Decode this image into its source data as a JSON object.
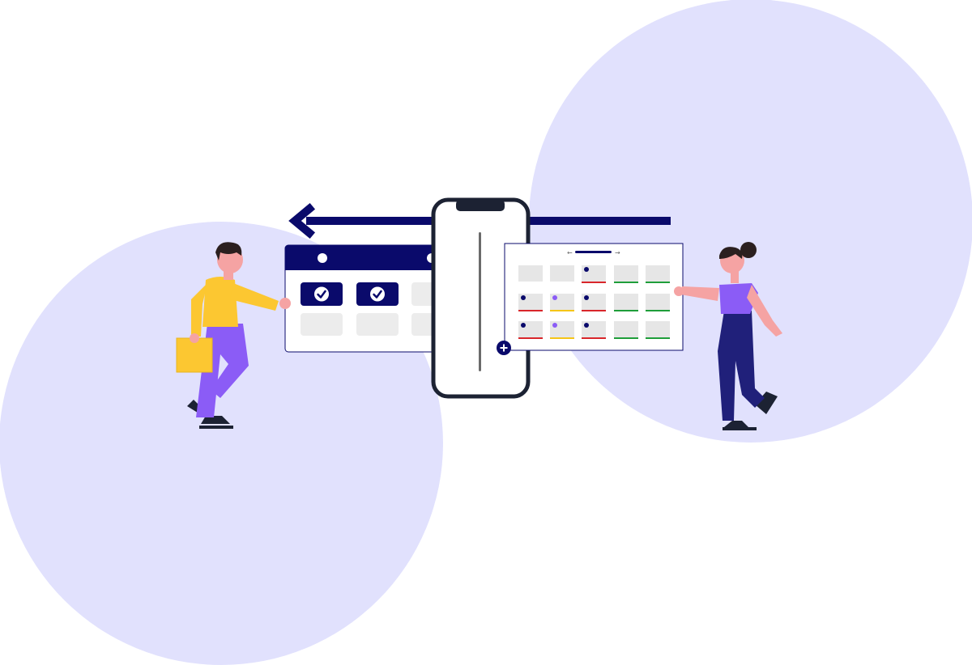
{
  "colors": {
    "background": "#ffffff",
    "circle": "#e1e1fd",
    "navy": "#0a0a6b",
    "phone_frame": "#1c2233",
    "card_border": "#0a0a6b",
    "cell": "#ececec",
    "check_fill": "#0a0a6b",
    "status_red": "#d9262b",
    "status_yellow": "#f5c518",
    "status_green": "#1f9e3a",
    "dot_purple": "#8b5cf6",
    "shirt_yellow": "#fcc731",
    "pants_purple": "#8b5cf6",
    "skin": "#f5a3a3",
    "hair": "#2b1f1f",
    "shirt_purple": "#8b5cf6",
    "pants_navy": "#20207a"
  },
  "left_calendar": {
    "checked_days": 2,
    "empty_days": 4,
    "icon": "check-icon"
  },
  "right_calendar": {
    "nav_prev_icon": "arrow-left-icon",
    "nav_next_icon": "arrow-right-icon",
    "grid_rows": [
      [
        "none",
        "none",
        "navy-red",
        "green",
        "green"
      ],
      [
        "navy-red",
        "purple-yellow",
        "navy-red",
        "green",
        "green"
      ],
      [
        "navy-red",
        "purple-yellow",
        "navy-red",
        "green",
        "green"
      ]
    ],
    "add_icon": "plus-icon"
  },
  "sync_arrow_icon": "arrow-left-icon"
}
